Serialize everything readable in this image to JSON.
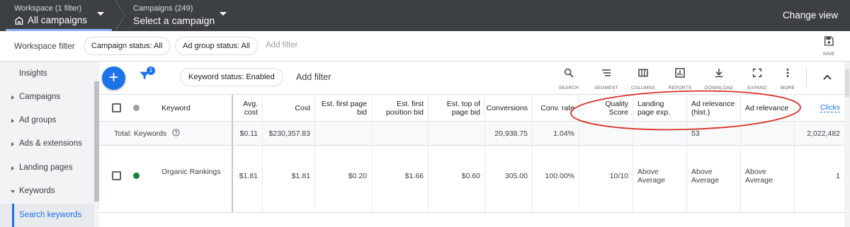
{
  "topbar": {
    "workspace_sub": "Workspace (1 filter)",
    "workspace_main": "All campaigns",
    "campaigns_sub": "Campaigns (249)",
    "campaigns_main": "Select a campaign",
    "change_view": "Change view"
  },
  "filterbar": {
    "label": "Workspace filter",
    "chips": [
      "Campaign status: All",
      "Ad group status: All"
    ],
    "add_filter": "Add filter",
    "save_label": "SAVE"
  },
  "sidebar": {
    "items": [
      {
        "label": "Insights",
        "arrow": "none"
      },
      {
        "label": "Campaigns",
        "arrow": "right"
      },
      {
        "label": "Ad groups",
        "arrow": "right"
      },
      {
        "label": "Ads & extensions",
        "arrow": "right"
      },
      {
        "label": "Landing pages",
        "arrow": "right"
      },
      {
        "label": "Keywords",
        "arrow": "down"
      },
      {
        "label": "Search keywords",
        "arrow": "none",
        "active": true
      }
    ]
  },
  "toolbar": {
    "filter_badge": "1",
    "keyword_status_chip": "Keyword status: Enabled",
    "add_filter": "Add filter",
    "tools": [
      {
        "icon": "search-icon",
        "label": "SEARCH"
      },
      {
        "icon": "segment-icon",
        "label": "SEGMENT"
      },
      {
        "icon": "columns-icon",
        "label": "COLUMNS"
      },
      {
        "icon": "reports-icon",
        "label": "REPORTS"
      },
      {
        "icon": "download-icon",
        "label": "DOWNLOAD"
      },
      {
        "icon": "expand-icon",
        "label": "EXPAND"
      },
      {
        "icon": "more-icon",
        "label": "MORE"
      }
    ]
  },
  "table": {
    "headers": {
      "keyword": "Keyword",
      "avg_cost": "Avg. cost",
      "cost": "Cost",
      "est_first_page_bid": "Est. first page bid",
      "est_first_position_bid": "Est. first position bid",
      "est_top_of_page_bid": "Est. top of page bid",
      "conversions": "Conversions",
      "conv_rate": "Conv. rate",
      "quality_score": "Quality Score",
      "landing_page_exp": "Landing page exp.",
      "ad_relevance_hist": "Ad relevance (hist.)",
      "ad_relevance": "Ad relevance",
      "clicks": "Clicks"
    },
    "total": {
      "label": "Total: Keywords",
      "avg_cost": "$0.11",
      "cost": "$230,357.83",
      "conversions": "20,938.75",
      "conv_rate": "1.04%",
      "ad_relevance_hist": "53",
      "clicks": "2,022,482"
    },
    "rows": [
      {
        "keyword": "Organic Rankings",
        "status_color": "#188038",
        "avg_cost": "$1.81",
        "cost": "$1.81",
        "est_first_page_bid": "$0.20",
        "est_first_position_bid": "$1.66",
        "est_top_of_page_bid": "$0.60",
        "conversions": "305.00",
        "conv_rate": "100.00%",
        "quality_score": "10/10",
        "landing_page_exp": "Above Average",
        "ad_relevance_hist": "Above Average",
        "ad_relevance": "Above Average",
        "clicks": "1"
      }
    ]
  },
  "colors": {
    "accent": "#1a73e8",
    "topbar": "#3c4043",
    "annotation_oval": "#d93025"
  }
}
